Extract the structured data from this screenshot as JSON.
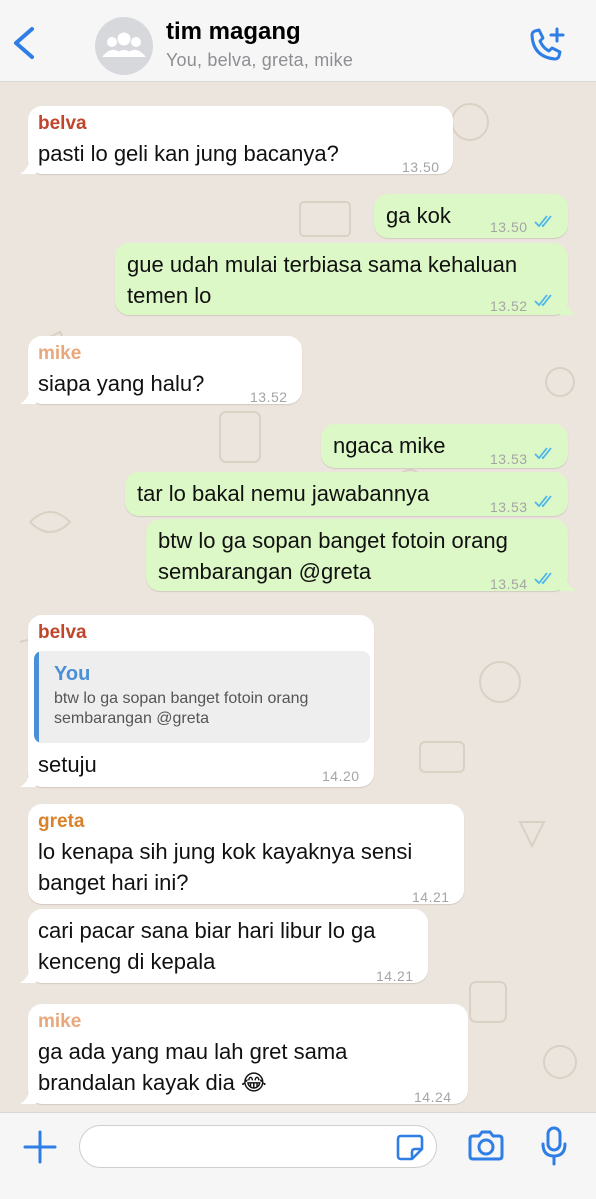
{
  "header": {
    "title": "tim magang",
    "subtitle": "You, belva, greta, mike",
    "back_icon": "chevron-left-icon",
    "avatar_icon": "group-avatar-icon",
    "call_icon": "add-call-icon"
  },
  "colors": {
    "accent": "#2f7ee6",
    "incoming_bubble": "#ffffff",
    "outgoing_bubble": "#dcf8c6",
    "read_ticks": "#4fb6ec",
    "belva": "#c0452b",
    "mike": "#e8a87c",
    "greta": "#d9822b",
    "quote_you": "#4a90d9"
  },
  "messages": [
    {
      "sender": "belva",
      "text": "pasti lo geli kan jung bacanya?",
      "time": "13.50"
    },
    {
      "text": "ga kok",
      "time": "13.50"
    },
    {
      "text": "gue udah mulai terbiasa sama kehaluan\ntemen lo",
      "time": "13.52"
    },
    {
      "sender": "mike",
      "text": "siapa yang halu?",
      "time": "13.52"
    },
    {
      "text": "ngaca mike",
      "time": "13.53"
    },
    {
      "text": "tar lo bakal nemu jawabannya",
      "time": "13.53"
    },
    {
      "text": "btw lo ga sopan banget fotoin orang\nsembarangan @greta",
      "time": "13.54"
    },
    {
      "sender": "belva",
      "quote_name": "You",
      "quote_text": "btw lo ga sopan banget fotoin orang sembarangan @greta",
      "text": "setuju",
      "time": "14.20"
    },
    {
      "sender": "greta",
      "text": "lo kenapa sih jung kok kayaknya sensi\nbanget hari ini?",
      "time": "14.21"
    },
    {
      "text": "cari pacar sana biar hari libur lo ga\nkenceng di kepala",
      "time": "14.21"
    },
    {
      "sender": "mike",
      "text": "ga ada yang mau lah gret sama\nbrandalan kayak dia 😂",
      "time": "14.24"
    }
  ],
  "footer": {
    "input_value": "",
    "plus_icon": "plus-icon",
    "sticker_icon": "sticker-icon",
    "camera_icon": "camera-icon",
    "mic_icon": "microphone-icon"
  }
}
